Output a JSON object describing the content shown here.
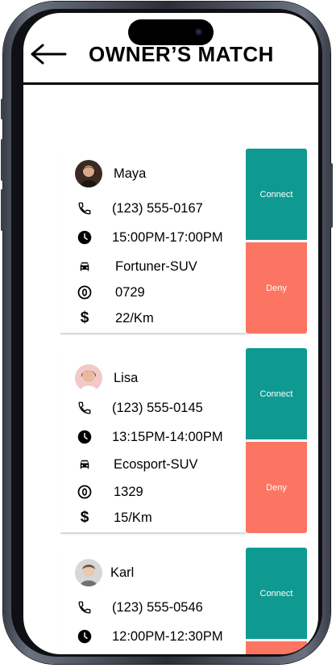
{
  "header": {
    "title": "OWNER’S MATCH"
  },
  "cards": [
    {
      "name": "Maya",
      "phone": "(123) 555-0167",
      "time": "15:00PM-17:00PM",
      "car": "Fortuner-SUV",
      "code": "0729",
      "rate": "22/Km",
      "connect_label": "Connect",
      "deny_label": "Deny"
    },
    {
      "name": "Lisa",
      "phone": "(123) 555-0145",
      "time": "13:15PM-14:00PM",
      "car": "Ecosport-SUV",
      "code": "1329",
      "rate": "15/Km",
      "connect_label": "Connect",
      "deny_label": "Deny"
    },
    {
      "name": "Karl",
      "phone": "(123) 555-0546",
      "time": "12:00PM-12:30PM",
      "connect_label": "Connect"
    }
  ],
  "colors": {
    "connect": "#0f9a91",
    "deny": "#fc7562"
  },
  "icons": [
    "back-arrow-icon",
    "phone-icon",
    "clock-icon",
    "car-icon",
    "code-icon",
    "dollar-icon"
  ]
}
